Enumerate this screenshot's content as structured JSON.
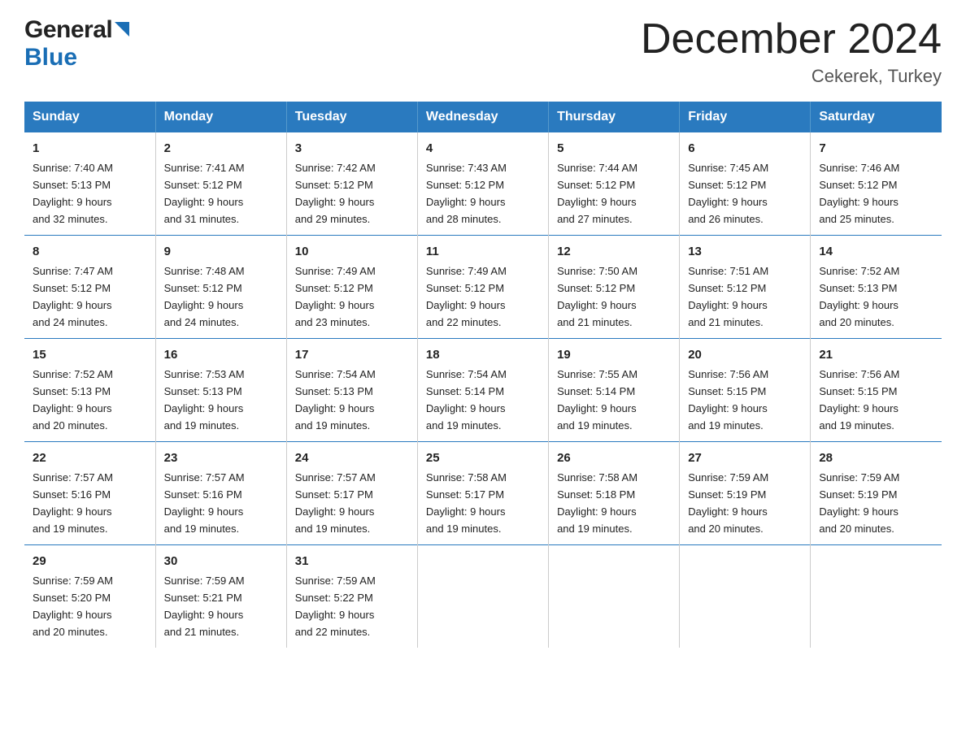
{
  "header": {
    "logo_general": "General",
    "logo_blue": "Blue",
    "main_title": "December 2024",
    "subtitle": "Cekerek, Turkey"
  },
  "days_of_week": [
    "Sunday",
    "Monday",
    "Tuesday",
    "Wednesday",
    "Thursday",
    "Friday",
    "Saturday"
  ],
  "weeks": [
    [
      {
        "num": "1",
        "sunrise": "7:40 AM",
        "sunset": "5:13 PM",
        "daylight": "9 hours and 32 minutes."
      },
      {
        "num": "2",
        "sunrise": "7:41 AM",
        "sunset": "5:12 PM",
        "daylight": "9 hours and 31 minutes."
      },
      {
        "num": "3",
        "sunrise": "7:42 AM",
        "sunset": "5:12 PM",
        "daylight": "9 hours and 29 minutes."
      },
      {
        "num": "4",
        "sunrise": "7:43 AM",
        "sunset": "5:12 PM",
        "daylight": "9 hours and 28 minutes."
      },
      {
        "num": "5",
        "sunrise": "7:44 AM",
        "sunset": "5:12 PM",
        "daylight": "9 hours and 27 minutes."
      },
      {
        "num": "6",
        "sunrise": "7:45 AM",
        "sunset": "5:12 PM",
        "daylight": "9 hours and 26 minutes."
      },
      {
        "num": "7",
        "sunrise": "7:46 AM",
        "sunset": "5:12 PM",
        "daylight": "9 hours and 25 minutes."
      }
    ],
    [
      {
        "num": "8",
        "sunrise": "7:47 AM",
        "sunset": "5:12 PM",
        "daylight": "9 hours and 24 minutes."
      },
      {
        "num": "9",
        "sunrise": "7:48 AM",
        "sunset": "5:12 PM",
        "daylight": "9 hours and 24 minutes."
      },
      {
        "num": "10",
        "sunrise": "7:49 AM",
        "sunset": "5:12 PM",
        "daylight": "9 hours and 23 minutes."
      },
      {
        "num": "11",
        "sunrise": "7:49 AM",
        "sunset": "5:12 PM",
        "daylight": "9 hours and 22 minutes."
      },
      {
        "num": "12",
        "sunrise": "7:50 AM",
        "sunset": "5:12 PM",
        "daylight": "9 hours and 21 minutes."
      },
      {
        "num": "13",
        "sunrise": "7:51 AM",
        "sunset": "5:12 PM",
        "daylight": "9 hours and 21 minutes."
      },
      {
        "num": "14",
        "sunrise": "7:52 AM",
        "sunset": "5:13 PM",
        "daylight": "9 hours and 20 minutes."
      }
    ],
    [
      {
        "num": "15",
        "sunrise": "7:52 AM",
        "sunset": "5:13 PM",
        "daylight": "9 hours and 20 minutes."
      },
      {
        "num": "16",
        "sunrise": "7:53 AM",
        "sunset": "5:13 PM",
        "daylight": "9 hours and 19 minutes."
      },
      {
        "num": "17",
        "sunrise": "7:54 AM",
        "sunset": "5:13 PM",
        "daylight": "9 hours and 19 minutes."
      },
      {
        "num": "18",
        "sunrise": "7:54 AM",
        "sunset": "5:14 PM",
        "daylight": "9 hours and 19 minutes."
      },
      {
        "num": "19",
        "sunrise": "7:55 AM",
        "sunset": "5:14 PM",
        "daylight": "9 hours and 19 minutes."
      },
      {
        "num": "20",
        "sunrise": "7:56 AM",
        "sunset": "5:15 PM",
        "daylight": "9 hours and 19 minutes."
      },
      {
        "num": "21",
        "sunrise": "7:56 AM",
        "sunset": "5:15 PM",
        "daylight": "9 hours and 19 minutes."
      }
    ],
    [
      {
        "num": "22",
        "sunrise": "7:57 AM",
        "sunset": "5:16 PM",
        "daylight": "9 hours and 19 minutes."
      },
      {
        "num": "23",
        "sunrise": "7:57 AM",
        "sunset": "5:16 PM",
        "daylight": "9 hours and 19 minutes."
      },
      {
        "num": "24",
        "sunrise": "7:57 AM",
        "sunset": "5:17 PM",
        "daylight": "9 hours and 19 minutes."
      },
      {
        "num": "25",
        "sunrise": "7:58 AM",
        "sunset": "5:17 PM",
        "daylight": "9 hours and 19 minutes."
      },
      {
        "num": "26",
        "sunrise": "7:58 AM",
        "sunset": "5:18 PM",
        "daylight": "9 hours and 19 minutes."
      },
      {
        "num": "27",
        "sunrise": "7:59 AM",
        "sunset": "5:19 PM",
        "daylight": "9 hours and 20 minutes."
      },
      {
        "num": "28",
        "sunrise": "7:59 AM",
        "sunset": "5:19 PM",
        "daylight": "9 hours and 20 minutes."
      }
    ],
    [
      {
        "num": "29",
        "sunrise": "7:59 AM",
        "sunset": "5:20 PM",
        "daylight": "9 hours and 20 minutes."
      },
      {
        "num": "30",
        "sunrise": "7:59 AM",
        "sunset": "5:21 PM",
        "daylight": "9 hours and 21 minutes."
      },
      {
        "num": "31",
        "sunrise": "7:59 AM",
        "sunset": "5:22 PM",
        "daylight": "9 hours and 22 minutes."
      },
      {
        "num": "",
        "sunrise": "",
        "sunset": "",
        "daylight": ""
      },
      {
        "num": "",
        "sunrise": "",
        "sunset": "",
        "daylight": ""
      },
      {
        "num": "",
        "sunrise": "",
        "sunset": "",
        "daylight": ""
      },
      {
        "num": "",
        "sunrise": "",
        "sunset": "",
        "daylight": ""
      }
    ]
  ],
  "labels": {
    "sunrise": "Sunrise:",
    "sunset": "Sunset:",
    "daylight": "Daylight:"
  }
}
